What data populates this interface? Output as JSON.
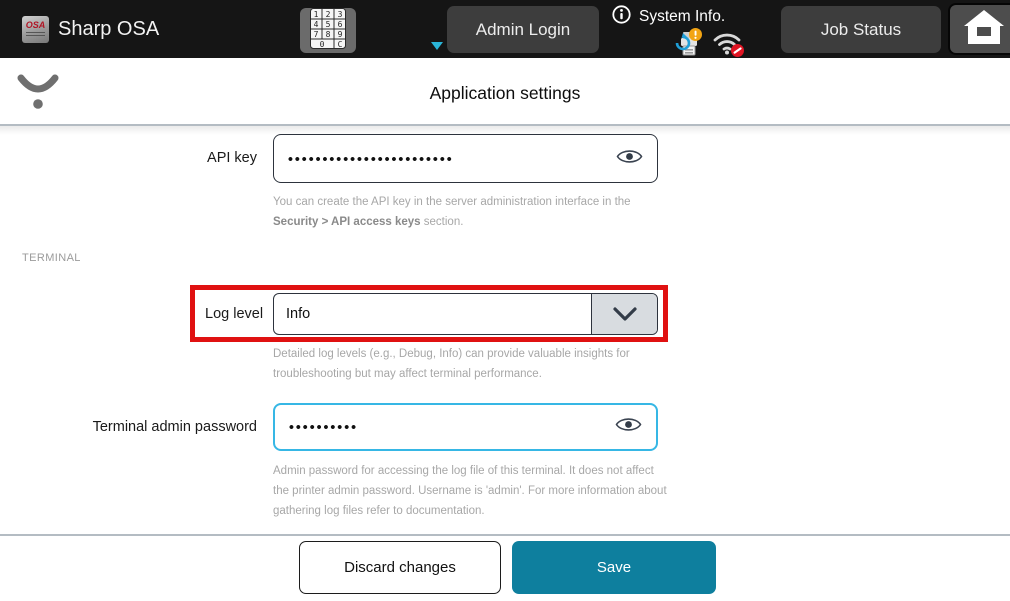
{
  "topbar": {
    "logo_text": "OSA",
    "app_title": "Sharp OSA",
    "admin_login_label": "Admin Login",
    "system_info_label": "System Info.",
    "job_status_label": "Job Status",
    "keypad_keys": [
      "1",
      "2",
      "3",
      "4",
      "5",
      "6",
      "7",
      "8",
      "9",
      "0",
      "C"
    ]
  },
  "header": {
    "title": "Application settings"
  },
  "form": {
    "api_key": {
      "label": "API key",
      "value_masked": "••••••••••••••••••••••••",
      "helper": [
        {
          "text": "You can create the API key in the server administration interface in the "
        },
        {
          "text": "Security > API access keys"
        },
        {
          "text": " section."
        }
      ]
    },
    "section_terminal": "TERMINAL",
    "log_level": {
      "label": "Log level",
      "value": "Info",
      "helper": "Detailed log levels (e.g., Debug, Info) can provide valuable insights for troubleshooting but may affect terminal performance."
    },
    "terminal_password": {
      "label": "Terminal admin password",
      "value_masked": "••••••••••",
      "helper": "Admin password for accessing the log file of this terminal. It does not affect the printer admin password. Username is 'admin'. For more information about gathering log files refer to documentation."
    }
  },
  "footer": {
    "discard_label": "Discard changes",
    "save_label": "Save"
  },
  "colors": {
    "save_teal": "#0e7f9e",
    "highlight_red": "#e01111",
    "focus_blue": "#36b7e5",
    "topbar_bg": "#151515"
  }
}
